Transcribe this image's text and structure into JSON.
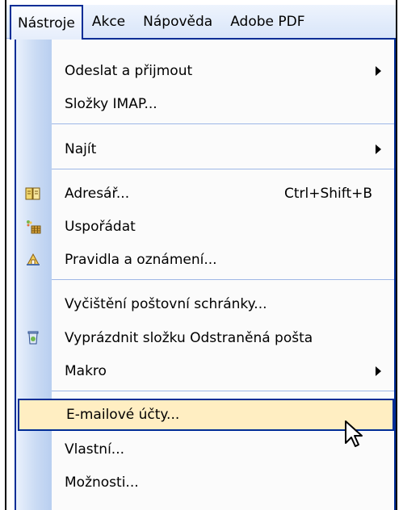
{
  "menubar": {
    "items": [
      {
        "label": "Nástroje",
        "active": true
      },
      {
        "label": "Akce",
        "active": false
      },
      {
        "label": "Nápověda",
        "active": false
      },
      {
        "label": "Adobe PDF",
        "active": false
      }
    ]
  },
  "dropdown": {
    "items": [
      {
        "label": "Odeslat a přijmout",
        "has_submenu": true
      },
      {
        "label": "Složky IMAP..."
      },
      {
        "label": "Najít",
        "has_submenu": true
      },
      {
        "label": "Adresář...",
        "shortcut": "Ctrl+Shift+B",
        "icon": "address-book-icon"
      },
      {
        "label": "Uspořádat",
        "icon": "organize-icon"
      },
      {
        "label": "Pravidla a oznámení...",
        "icon": "rules-icon"
      },
      {
        "label": "Vyčištění poštovní schránky..."
      },
      {
        "label": "Vyprázdnit složku  Odstraněná pošta",
        "icon": "recycle-bin-icon"
      },
      {
        "label": "Makro",
        "has_submenu": true
      },
      {
        "label": "E-mailové účty...",
        "selected": true
      },
      {
        "label": "Vlastní..."
      },
      {
        "label": "Možnosti..."
      }
    ]
  },
  "colors": {
    "highlight": "#ffeec2",
    "border": "#002d96",
    "gutter": "#cadbf4"
  }
}
